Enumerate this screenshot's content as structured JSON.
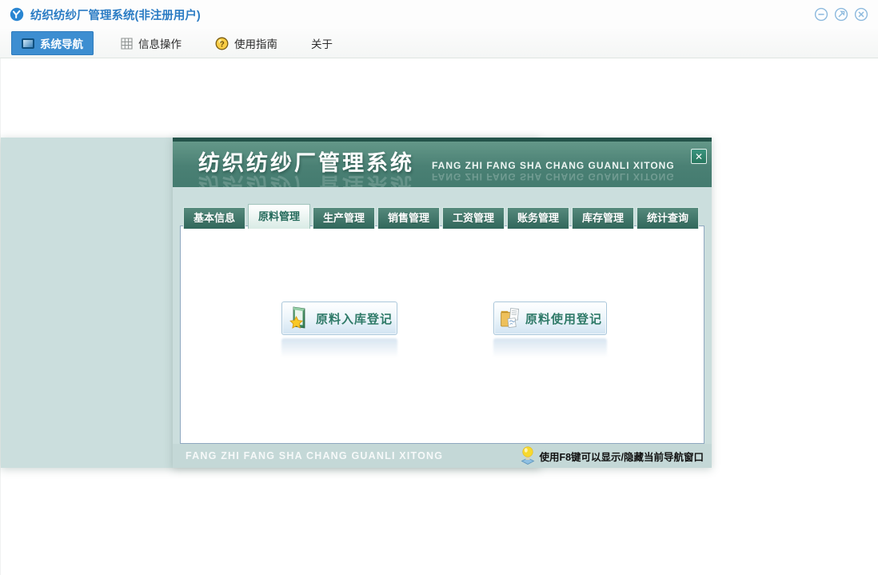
{
  "window": {
    "title": "纺织纺纱厂管理系统(非注册用户)",
    "controls": [
      {
        "name": "minimize"
      },
      {
        "name": "maximize"
      },
      {
        "name": "close"
      }
    ]
  },
  "toolbar": {
    "items": [
      {
        "label": "系统导航",
        "icon": "monitor-icon",
        "active": true
      },
      {
        "label": "信息操作",
        "icon": "grid-icon",
        "active": false
      },
      {
        "label": "使用指南",
        "icon": "coin-icon",
        "active": false
      },
      {
        "label": "关于",
        "icon": "",
        "active": false
      }
    ]
  },
  "dialog": {
    "title": "纺织纺纱厂管理系统",
    "subtitle": "FANG ZHI FANG SHA CHANG GUANLI XITONG",
    "close_glyph": "✕",
    "tabs": [
      {
        "label": "基本信息",
        "active": false
      },
      {
        "label": "原料管理",
        "active": true
      },
      {
        "label": "生产管理",
        "active": false
      },
      {
        "label": "销售管理",
        "active": false
      },
      {
        "label": "工资管理",
        "active": false
      },
      {
        "label": "账务管理",
        "active": false
      },
      {
        "label": "库存管理",
        "active": false
      },
      {
        "label": "统计查询",
        "active": false
      }
    ],
    "buttons": [
      {
        "label": "原料入库登记",
        "icon": "green-folder-star-icon"
      },
      {
        "label": "原料使用登记",
        "icon": "yellow-folder-docs-icon"
      }
    ],
    "footer": {
      "left_text": "FANG ZHI FANG SHA CHANG GUANLI XITONG",
      "tip_text": "使用F8键可以显示/隐藏当前导航窗口"
    }
  },
  "colors": {
    "accent_blue": "#3d8ed1",
    "titlebar_text": "#2b7cc4",
    "header_green": "#4f8579",
    "dialog_band": "#cbdedd",
    "footer_bar": "#c4d8d7",
    "tab_dark_green": "#3c756a",
    "active_tab_text": "#23695a",
    "button_text": "#2f7a68",
    "close_button_green": "#2f8872"
  }
}
